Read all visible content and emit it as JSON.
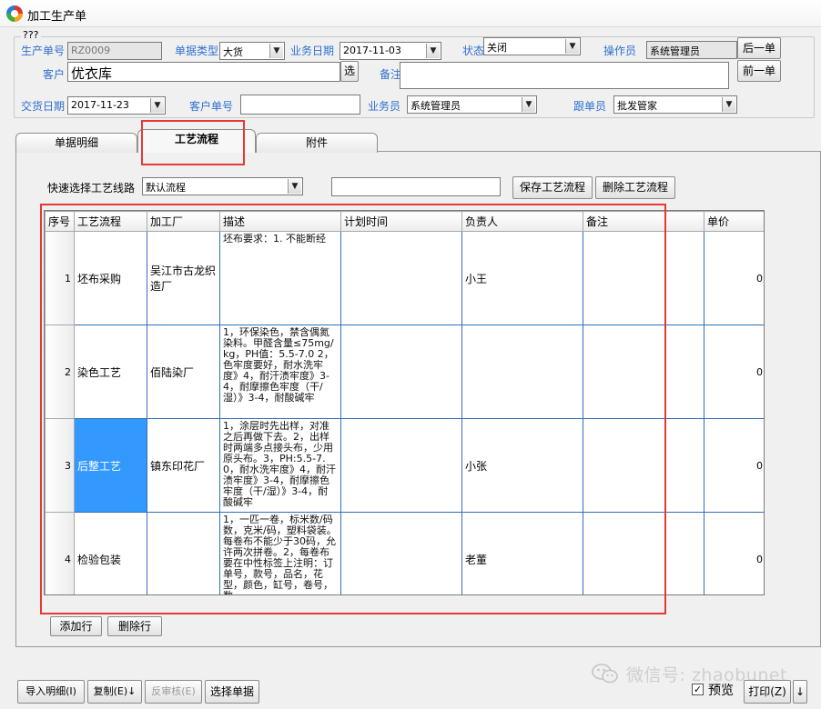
{
  "window": {
    "title": "加工生产单"
  },
  "group_caption": "???",
  "header": {
    "order_no_label": "生产单号",
    "order_no_value": "RZ0009",
    "doc_type_label": "单据类型",
    "doc_type_value": "大货",
    "biz_date_label": "业务日期",
    "biz_date_value": "2017-11-03",
    "status_label": "状态",
    "status_value": "关闭",
    "operator_label": "操作员",
    "operator_value": "系统管理员",
    "next_btn": "后一单",
    "prev_btn": "前一单",
    "customer_label": "客户",
    "customer_value": "优衣库",
    "select_btn": "选",
    "remark_label": "备注",
    "remark_value": "",
    "delivery_label": "交货日期",
    "delivery_value": "2017-11-23",
    "cust_no_label": "客户单号",
    "cust_no_value": "",
    "salesman_label": "业务员",
    "salesman_value": "系统管理员",
    "follower_label": "跟单员",
    "follower_value": "批发管家"
  },
  "tabs": [
    {
      "label": "单据明细"
    },
    {
      "label": "工艺流程"
    },
    {
      "label": "附件"
    }
  ],
  "toolbar": {
    "route_label": "快速选择工艺线路",
    "route_value": "默认流程",
    "route_name_value": "",
    "save_btn": "保存工艺流程",
    "delete_btn": "删除工艺流程"
  },
  "grid": {
    "columns": [
      "序号",
      "工艺流程",
      "加工厂",
      "描述",
      "计划时间",
      "负责人",
      "备注",
      "单价"
    ],
    "rows": [
      {
        "no": "1",
        "process": "坯布采购",
        "factory": "吴江市古龙织造厂",
        "desc": "坯布要求：1. 不能断经",
        "plan": "",
        "owner": "小王",
        "remark": "",
        "price": "0"
      },
      {
        "no": "2",
        "process": "染色工艺",
        "factory": "佰陆染厂",
        "desc": "1，环保染色，禁含偶氮染料。甲醛含量≤75mg/kg，PH值：5.5-7.0 2，色牢度要好，耐水洗牢度》4，耐汗渍牢度》3-4，耐摩擦色牢度（干/湿）》3-4，耐酸碱牢",
        "plan": "",
        "owner": "",
        "remark": "",
        "price": "0"
      },
      {
        "no": "3",
        "process": "后整工艺",
        "factory": "镇东印花厂",
        "desc": "1，涂层时先出样，对准之后再做下去。2，出样时两端多点接头布，少用原头布。3，PH:5.5-7.0，耐水洗牢度》4，耐汗渍牢度》3-4，耐摩擦色牢度（干/湿）》3-4，耐酸碱牢",
        "plan": "",
        "owner": "小张",
        "remark": "",
        "price": "0"
      },
      {
        "no": "4",
        "process": "检验包装",
        "factory": "",
        "desc": "1，一匹一卷，标米数/码数，克米/码，塑料袋装。每卷布不能少于30码，允许两次拼卷。2，每卷布要在中性标签上注明：订单号，款号，品名，花型，颜色，缸号，卷号，数",
        "plan": "",
        "owner": "老董",
        "remark": "",
        "price": "0"
      }
    ]
  },
  "grid_buttons": {
    "add_row": "添加行",
    "delete_row": "删除行"
  },
  "bottom": {
    "import_btn": "导入明细(I)",
    "copy_btn": "复制(E)↓",
    "unapprove_btn": "反审核(E)",
    "select_doc_btn": "选择单据",
    "preview_label": "预览",
    "preview_checked": "✓",
    "print_btn": "打印(Z)",
    "print_arrow": "↓"
  },
  "watermark": "微信号: zhaobunet",
  "colors": {
    "accent_label": "#2e6fd1",
    "selection": "#3399ff",
    "highlight": "#e53935"
  }
}
